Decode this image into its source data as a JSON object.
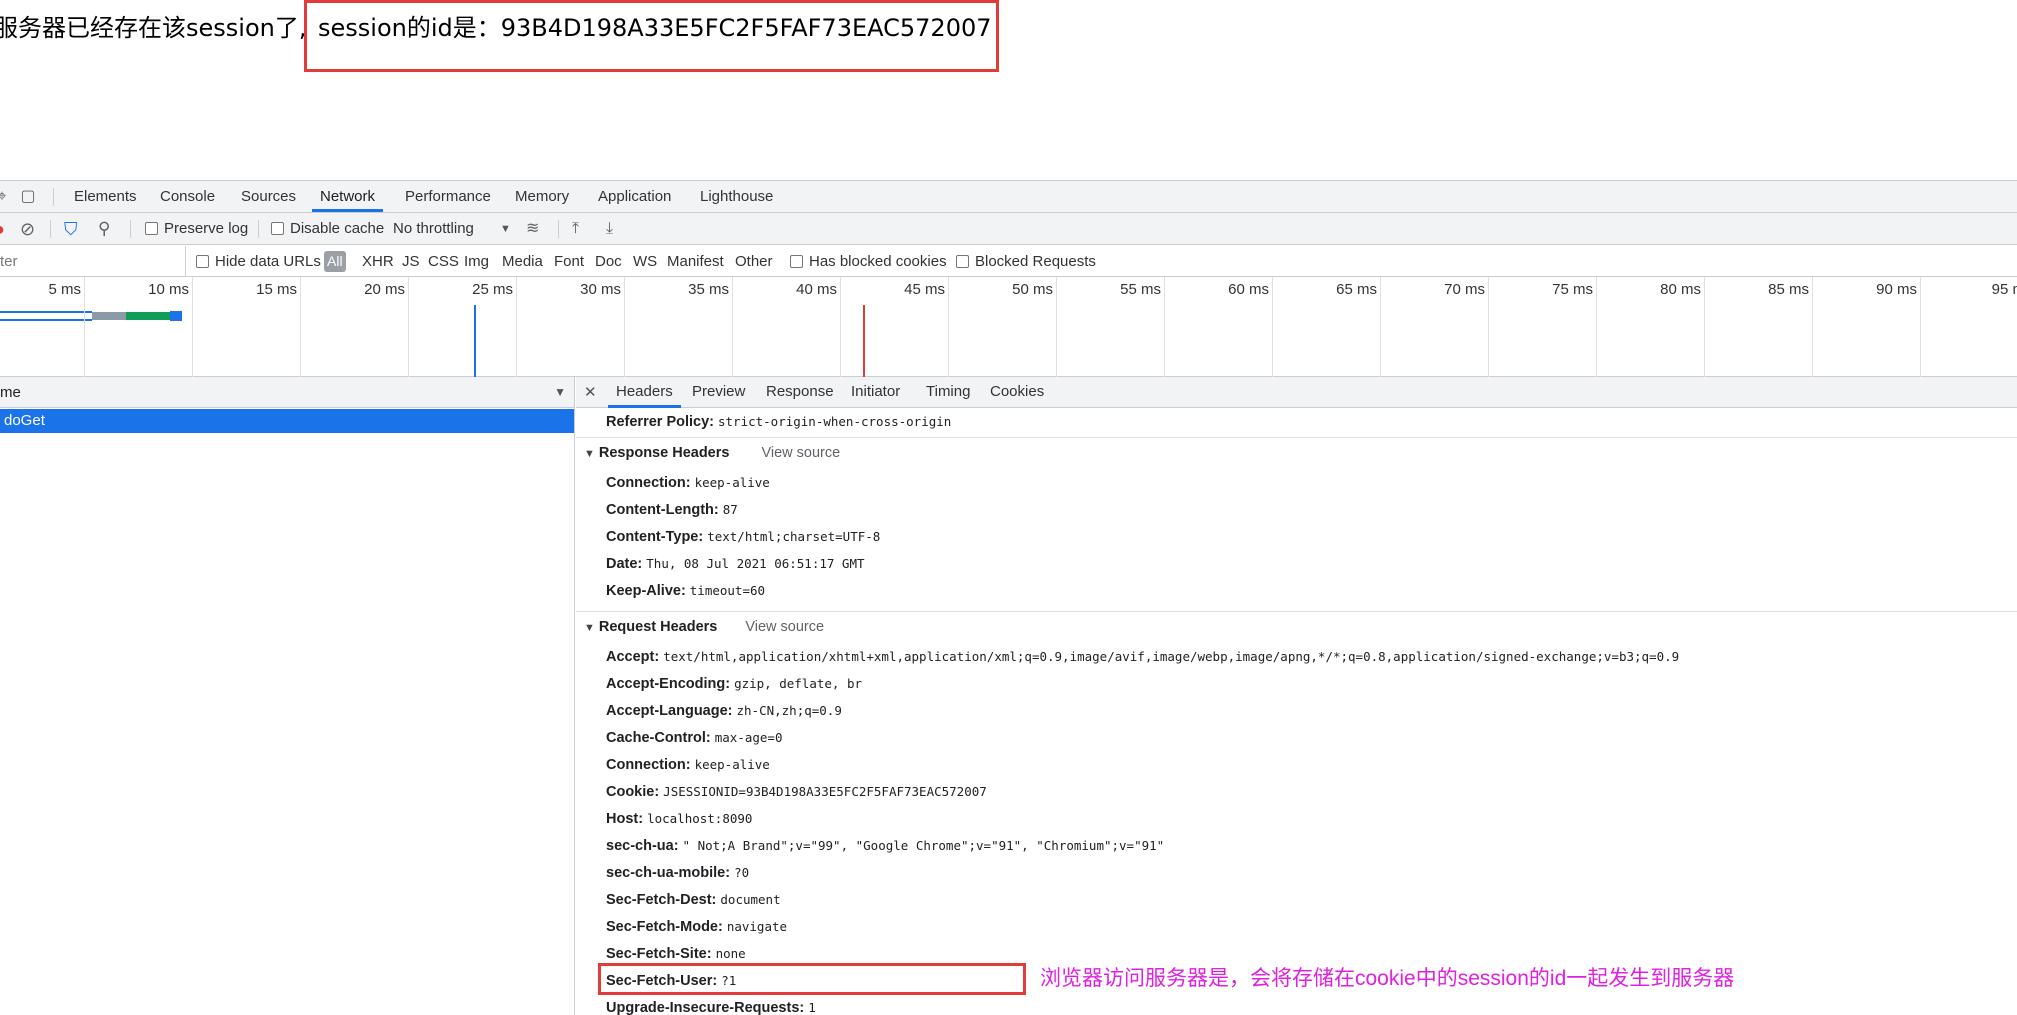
{
  "page": {
    "prefix_text": "服务器已经存在该session了,",
    "highlight_text": "session的id是：93B4D198A33E5FC2F5FAF73EAC572007"
  },
  "devtools": {
    "tabs": [
      "Elements",
      "Console",
      "Sources",
      "Network",
      "Performance",
      "Memory",
      "Application",
      "Lighthouse"
    ],
    "active_tab": "Network",
    "toolbar": {
      "preserve_log": "Preserve log",
      "disable_cache": "Disable cache",
      "throttling": "No throttling",
      "throttling_arrow": "▼"
    },
    "filterbar": {
      "filter_placeholder": "ter",
      "hide_data_urls": "Hide data URLs",
      "all": "All",
      "types": [
        "XHR",
        "JS",
        "CSS",
        "Img",
        "Media",
        "Font",
        "Doc",
        "WS",
        "Manifest",
        "Other"
      ],
      "has_blocked_cookies": "Has blocked cookies",
      "blocked_requests": "Blocked Requests"
    },
    "timeline": {
      "ticks": [
        "5 ms",
        "10 ms",
        "15 ms",
        "20 ms",
        "25 ms",
        "30 ms",
        "35 ms",
        "40 ms",
        "45 ms",
        "50 ms",
        "55 ms",
        "60 ms",
        "65 ms",
        "70 ms",
        "75 ms",
        "80 ms",
        "85 ms",
        "90 ms",
        "95 m"
      ],
      "dom_content_loaded_ms": 23,
      "load_ms": 41
    },
    "request_list": {
      "header": "me",
      "rows": [
        "doGet"
      ]
    },
    "detail_tabs": [
      "Headers",
      "Preview",
      "Response",
      "Initiator",
      "Timing",
      "Cookies"
    ],
    "active_detail_tab": "Headers",
    "referrer": {
      "name": "Referrer Policy:",
      "value": "strict-origin-when-cross-origin"
    },
    "response_headers": {
      "title": "Response Headers",
      "view_source": "View source",
      "items": [
        {
          "name": "Connection:",
          "value": "keep-alive"
        },
        {
          "name": "Content-Length:",
          "value": "87"
        },
        {
          "name": "Content-Type:",
          "value": "text/html;charset=UTF-8"
        },
        {
          "name": "Date:",
          "value": "Thu, 08 Jul 2021 06:51:17 GMT"
        },
        {
          "name": "Keep-Alive:",
          "value": "timeout=60"
        }
      ]
    },
    "request_headers": {
      "title": "Request Headers",
      "view_source": "View source",
      "items": [
        {
          "name": "Accept:",
          "value": "text/html,application/xhtml+xml,application/xml;q=0.9,image/avif,image/webp,image/apng,*/*;q=0.8,application/signed-exchange;v=b3;q=0.9"
        },
        {
          "name": "Accept-Encoding:",
          "value": "gzip, deflate, br"
        },
        {
          "name": "Accept-Language:",
          "value": "zh-CN,zh;q=0.9"
        },
        {
          "name": "Cache-Control:",
          "value": "max-age=0"
        },
        {
          "name": "Connection:",
          "value": "keep-alive"
        },
        {
          "name": "Cookie:",
          "value": "JSESSIONID=93B4D198A33E5FC2F5FAF73EAC572007"
        },
        {
          "name": "Host:",
          "value": "localhost:8090"
        },
        {
          "name": "sec-ch-ua:",
          "value": "\" Not;A Brand\";v=\"99\", \"Google Chrome\";v=\"91\", \"Chromium\";v=\"91\""
        },
        {
          "name": "sec-ch-ua-mobile:",
          "value": "?0"
        },
        {
          "name": "Sec-Fetch-Dest:",
          "value": "document"
        },
        {
          "name": "Sec-Fetch-Mode:",
          "value": "navigate"
        },
        {
          "name": "Sec-Fetch-Site:",
          "value": "none"
        },
        {
          "name": "Sec-Fetch-User:",
          "value": "?1"
        },
        {
          "name": "Upgrade-Insecure-Requests:",
          "value": "1"
        }
      ]
    },
    "annotation": "浏览器访问服务器是，会将存储在cookie中的session的id一起发生到服务器",
    "colors": {
      "accent": "#1a73e8",
      "highlight_border": "#e03c3c",
      "annotation": "#e020e0",
      "record": "#e53935"
    }
  }
}
